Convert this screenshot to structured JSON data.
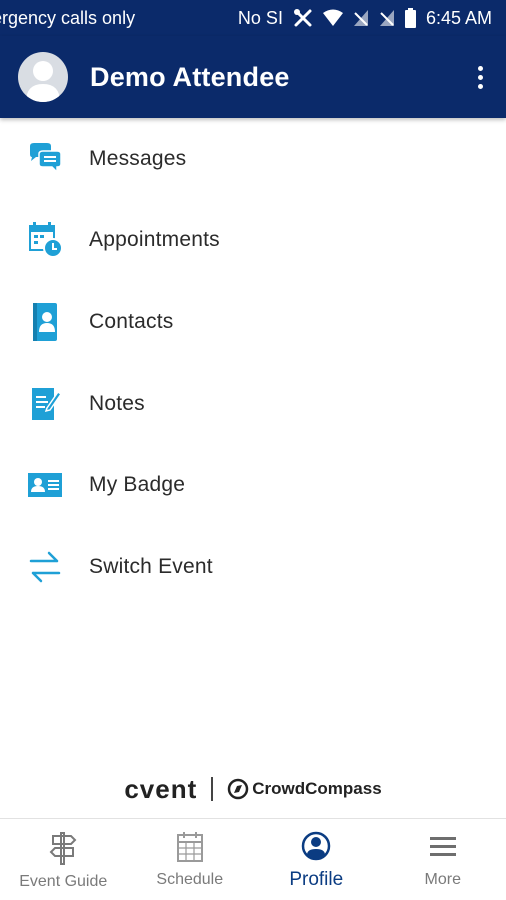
{
  "status_bar": {
    "carrier_text": "ergency calls only",
    "sim_text": "No SI",
    "time": "6:45 AM"
  },
  "header": {
    "user_name": "Demo Attendee"
  },
  "menu": {
    "items": [
      {
        "label": "Messages",
        "icon": "messages-icon"
      },
      {
        "label": "Appointments",
        "icon": "calendar-clock-icon"
      },
      {
        "label": "Contacts",
        "icon": "contact-book-icon"
      },
      {
        "label": "Notes",
        "icon": "note-edit-icon"
      },
      {
        "label": "My Badge",
        "icon": "badge-card-icon"
      },
      {
        "label": "Switch Event",
        "icon": "switch-arrows-icon"
      }
    ]
  },
  "footer_brand": {
    "cvent": "cvent",
    "crowdcompass": "CrowdCompass"
  },
  "bottom_nav": {
    "items": [
      {
        "label": "Event Guide",
        "icon": "signpost-icon"
      },
      {
        "label": "Schedule",
        "icon": "calendar-grid-icon"
      },
      {
        "label": "Profile",
        "icon": "profile-icon",
        "active": true
      },
      {
        "label": "More",
        "icon": "hamburger-icon"
      }
    ]
  },
  "colors": {
    "header_bg": "#0b2a6a",
    "icon_accent": "#1fa0d6",
    "active_nav": "#0b3c82"
  }
}
